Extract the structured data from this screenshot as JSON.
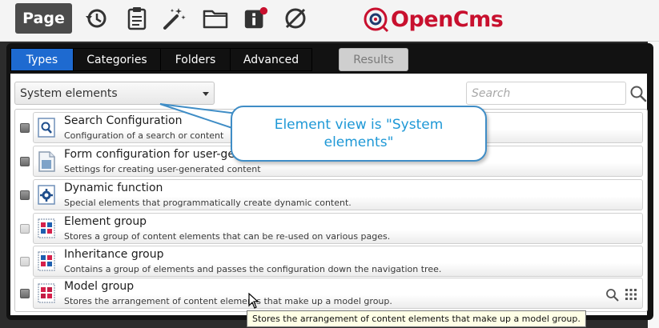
{
  "toolbar": {
    "page_label": "Page",
    "icons": [
      "history-icon",
      "clipboard-icon",
      "wand-icon",
      "folder-icon",
      "info-icon",
      "block-icon"
    ],
    "logo_text": "OpenCms"
  },
  "dialog": {
    "tabs": [
      {
        "label": "Types",
        "active": true
      },
      {
        "label": "Categories",
        "active": false
      },
      {
        "label": "Folders",
        "active": false
      },
      {
        "label": "Advanced",
        "active": false
      }
    ],
    "results_label": "Results",
    "view_select": "System elements",
    "search_placeholder": "Search"
  },
  "elements": [
    {
      "title": "Search Configuration",
      "description": "Configuration of a search or content",
      "icon": "search-config-icon",
      "checkbox_enabled": true
    },
    {
      "title": "Form configuration for user-generated content",
      "description": "Settings for creating user-generated content",
      "icon": "form-config-icon",
      "checkbox_enabled": true
    },
    {
      "title": "Dynamic function",
      "description": "Special elements that programmatically create dynamic content.",
      "icon": "dynamic-function-icon",
      "checkbox_enabled": true
    },
    {
      "title": "Element group",
      "description": "Stores a group of content elements that can be re-used on various pages.",
      "icon": "element-group-icon",
      "checkbox_enabled": false
    },
    {
      "title": "Inheritance group",
      "description": "Contains a group of elements and passes the configuration down the navigation tree.",
      "icon": "inheritance-group-icon",
      "checkbox_enabled": false
    },
    {
      "title": "Model group",
      "description": "Stores the arrangement of content elements that make up a model group.",
      "icon": "model-group-icon",
      "checkbox_enabled": true
    }
  ],
  "callout": {
    "text": "Element view is \"System elements\""
  },
  "tooltip": {
    "text": "Stores the arrangement of content elements that make up a model group."
  },
  "colors": {
    "accent": "#1e6ad0",
    "logo": "#c8102e",
    "callout_text": "#1e98d6",
    "callout_border": "#3f8dc6"
  }
}
